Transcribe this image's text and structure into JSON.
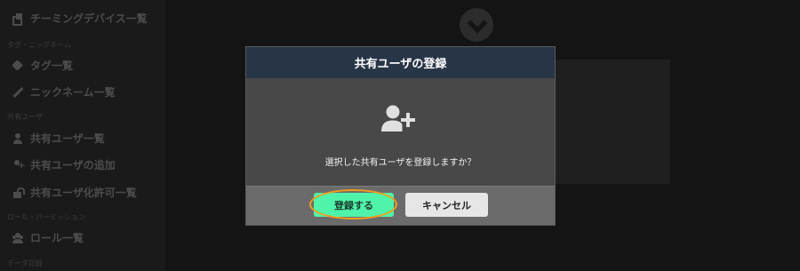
{
  "sidebar": {
    "items": [
      {
        "label": "チーミングデバイス一覧",
        "icon": "copy-icon"
      },
      {
        "label": "タグ一覧",
        "icon": "tag-icon"
      },
      {
        "label": "ニックネーム一覧",
        "icon": "pencil-icon"
      },
      {
        "label": "共有ユーザ一覧",
        "icon": "user-icon"
      },
      {
        "label": "共有ユーザの追加",
        "icon": "user-plus-icon"
      },
      {
        "label": "共有ユーザ化許可一覧",
        "icon": "unlock-icon"
      },
      {
        "label": "ロール一覧",
        "icon": "users-icon"
      }
    ],
    "sections": [
      {
        "label": "タグ・ニックネーム"
      },
      {
        "label": "共有ユーザ"
      },
      {
        "label": "ロール・パーミッション"
      },
      {
        "label": "データ記録"
      }
    ]
  },
  "modal": {
    "title": "共有ユーザの登録",
    "icon": "user-plus-icon",
    "message": "選択した共有ユーザを登録しますか？",
    "confirm_label": "登録する",
    "cancel_label": "キャンセル"
  },
  "colors": {
    "header": "#273547",
    "confirm_button": "#4ff3a9",
    "highlight": "#f39c1c"
  }
}
